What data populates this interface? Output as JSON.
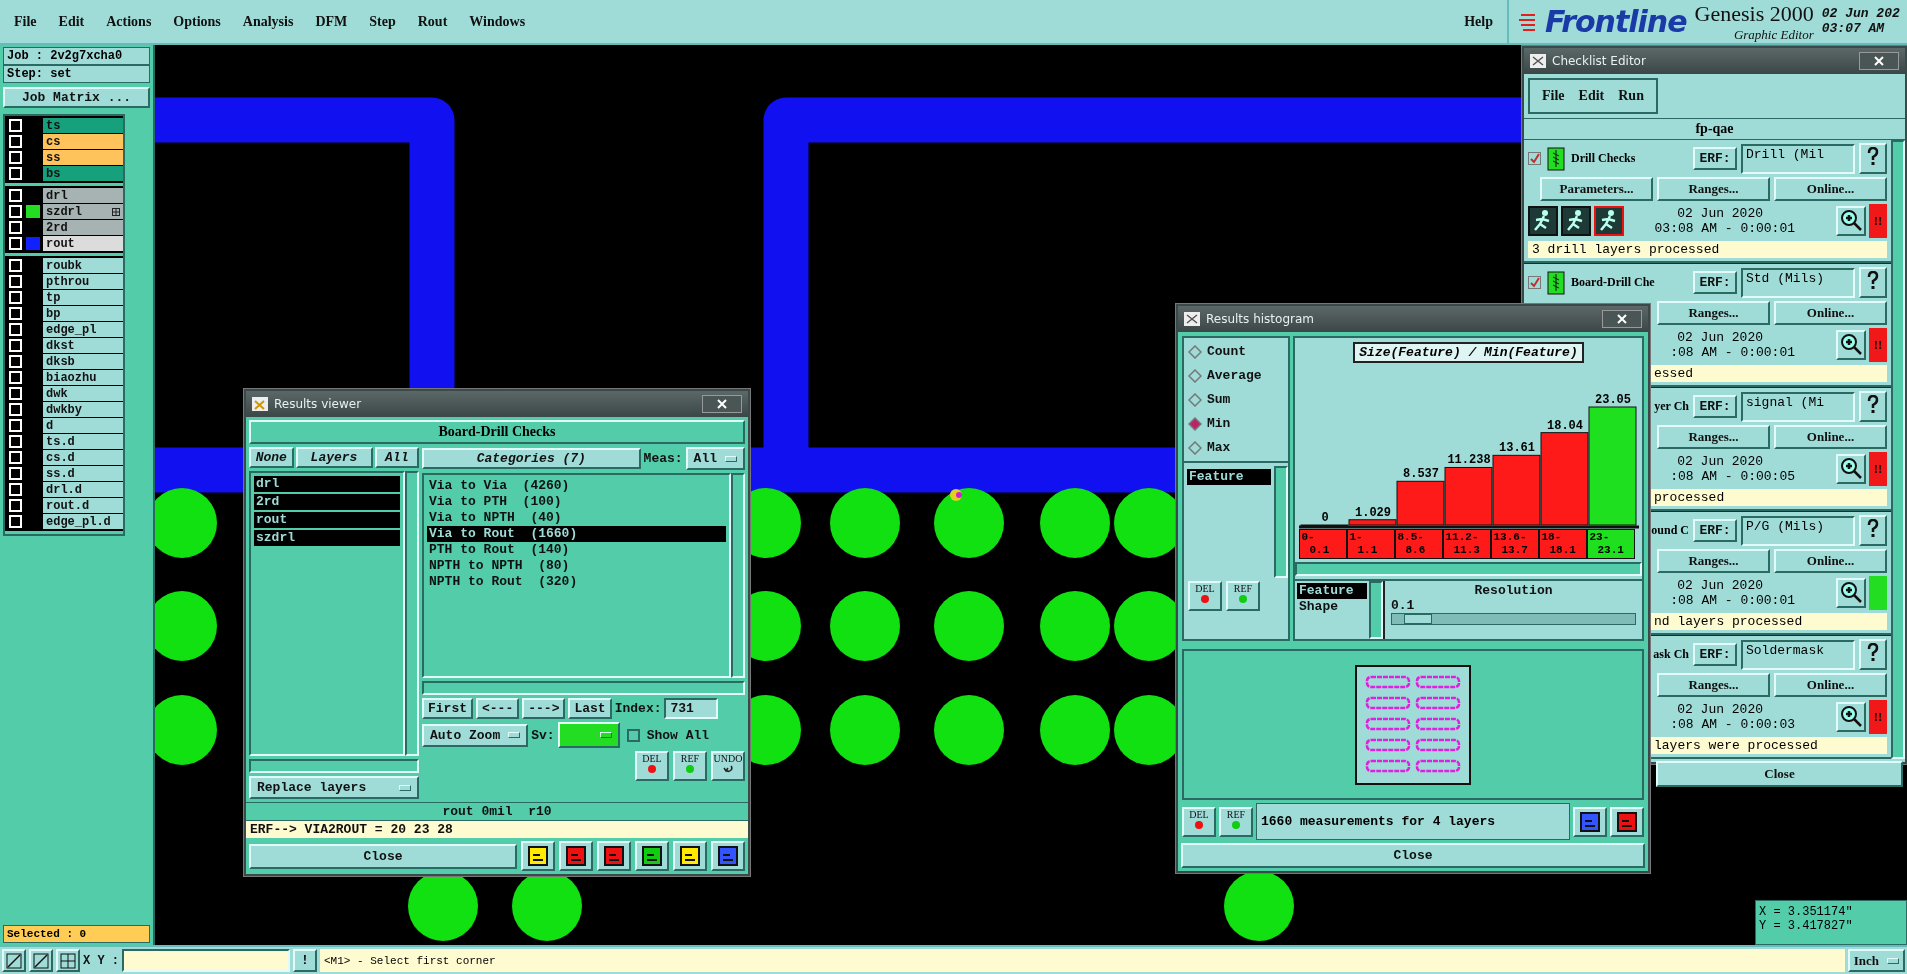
{
  "menu_bar": {
    "items": [
      "File",
      "Edit",
      "Actions",
      "Options",
      "Analysis",
      "DFM",
      "Step",
      "Rout",
      "Windows"
    ],
    "help": "Help"
  },
  "branding": {
    "logo": "Frontline",
    "product": "Genesis 2000",
    "subtitle": "Graphic Editor",
    "date": "02 Jun 202",
    "time": "03:07 AM"
  },
  "job_panel": {
    "job": "Job : 2v2g7xcha0",
    "step": "Step: set",
    "matrix_button": "Job Matrix ...",
    "layer_groups": [
      {
        "layers": [
          {
            "name": "ts",
            "color": "#16a07c",
            "checked": false
          },
          {
            "name": "cs",
            "color": "#ffc35c",
            "checked": false
          },
          {
            "name": "ss",
            "color": "#ffc35c",
            "checked": false
          },
          {
            "name": "bs",
            "color": "#16a07c",
            "checked": false
          }
        ]
      },
      {
        "layers": [
          {
            "name": "drl",
            "color": "#a7b2b2",
            "checked": false
          },
          {
            "name": "szdrl",
            "color": "#a7b2b2",
            "checked": false,
            "swatch": {
              "color": "#22dd22"
            },
            "attributes": true
          },
          {
            "name": "2rd",
            "color": "#a7b2b2",
            "checked": false
          },
          {
            "name": "rout",
            "color": "#dcdcdc",
            "checked": false,
            "swatch": {
              "color": "#1020ff"
            }
          }
        ]
      },
      {
        "layers": [
          {
            "name": "roubk",
            "color": "#9fdcd8",
            "checked": false
          },
          {
            "name": "pthrou",
            "color": "#9fdcd8",
            "checked": false
          },
          {
            "name": "tp",
            "color": "#9fdcd8",
            "checked": false
          },
          {
            "name": "bp",
            "color": "#9fdcd8",
            "checked": false
          },
          {
            "name": "edge_pl",
            "color": "#9fdcd8",
            "checked": false
          },
          {
            "name": "dkst",
            "color": "#9fdcd8",
            "checked": false
          },
          {
            "name": "dksb",
            "color": "#9fdcd8",
            "checked": false
          },
          {
            "name": "biaozhu",
            "color": "#9fdcd8",
            "checked": false
          },
          {
            "name": "dwk",
            "color": "#9fdcd8",
            "checked": false
          },
          {
            "name": "dwkby",
            "color": "#9fdcd8",
            "checked": false
          },
          {
            "name": "d",
            "color": "#9fdcd8",
            "checked": false
          },
          {
            "name": "ts.d",
            "color": "#9fdcd8",
            "checked": false
          },
          {
            "name": "cs.d",
            "color": "#9fdcd8",
            "checked": false
          },
          {
            "name": "ss.d",
            "color": "#9fdcd8",
            "checked": false
          },
          {
            "name": "drl.d",
            "color": "#9fdcd8",
            "checked": false
          },
          {
            "name": "rout.d",
            "color": "#9fdcd8",
            "checked": false
          },
          {
            "name": "edge_pl.d",
            "color": "#9fdcd8",
            "checked": false
          }
        ]
      }
    ],
    "selected": "Selected : 0"
  },
  "results_viewer": {
    "title": "Results viewer",
    "heading": "Board-Drill Checks",
    "layer_buttons": [
      "None",
      "Layers",
      "All"
    ],
    "layers": [
      {
        "name": "drl",
        "selected": true
      },
      {
        "name": "2rd",
        "selected": true
      },
      {
        "name": "rout",
        "selected": true
      },
      {
        "name": "szdrl",
        "selected": true
      }
    ],
    "categories_button": "Categories (7)",
    "meas_label": "Meas:",
    "meas_value": "All",
    "categories": [
      {
        "label": "Via to Via  (4260)",
        "selected": false
      },
      {
        "label": "Via to PTH  (100)",
        "selected": false
      },
      {
        "label": "Via to NPTH  (40)",
        "selected": false
      },
      {
        "label": "Via to Rout  (1660)",
        "selected": true
      },
      {
        "label": "PTH to Rout  (140)",
        "selected": false
      },
      {
        "label": "NPTH to NPTH  (80)",
        "selected": false
      },
      {
        "label": "NPTH to Rout  (320)",
        "selected": false
      }
    ],
    "nav_buttons": [
      "First",
      "<---",
      "--->",
      "Last"
    ],
    "index_label": "Index:",
    "index_value": "731",
    "zoom_mode": "Auto Zoom",
    "sv_label": "Sv:",
    "show_all": {
      "label": "Show All",
      "checked": false
    },
    "replace_mode": "Replace layers",
    "actions": [
      {
        "label": "DEL",
        "kind": "delete"
      },
      {
        "label": "REF",
        "kind": "refresh"
      },
      {
        "label": "UNDO",
        "kind": "undo"
      }
    ],
    "info": "rout 0mil  r10",
    "erf": "ERF--> VIA2ROUT = 20 23 28",
    "close": "Close"
  },
  "histogram": {
    "title": "Results histogram",
    "modes": [
      {
        "label": "Count",
        "selected": false
      },
      {
        "label": "Average",
        "selected": false
      },
      {
        "label": "Sum",
        "selected": false
      },
      {
        "label": "Min",
        "selected": true
      },
      {
        "label": "Max",
        "selected": false
      }
    ],
    "fields": [
      {
        "label": "Feature",
        "selected": true
      }
    ],
    "actions": [
      {
        "label": "DEL",
        "kind": "delete"
      },
      {
        "label": "REF",
        "kind": "refresh"
      }
    ],
    "chart_data": {
      "type": "bar",
      "title": "Size(Feature) / Min(Feature)",
      "categories": [
        "0-0.1",
        "1-1.1",
        "8.5-8.6",
        "11.2-11.3",
        "13.6-13.7",
        "18-18.1",
        "23-23.1"
      ],
      "series": [
        {
          "color": "#ff1a1a",
          "values": [
            0,
            1.029,
            8.537,
            11.238,
            13.61,
            18.04,
            null
          ]
        },
        {
          "color": "#1ee01e",
          "values": [
            null,
            null,
            null,
            null,
            null,
            null,
            23.05
          ]
        }
      ],
      "data_labels": true
    },
    "group_by": [
      {
        "label": "Feature",
        "selected": true
      },
      {
        "label": "Shape",
        "selected": false
      }
    ],
    "resolution": {
      "label": "Resolution",
      "value": "0.1",
      "level": 0.05
    },
    "summary_actions": [
      {
        "label": "DEL",
        "kind": "delete"
      },
      {
        "label": "REF",
        "kind": "refresh"
      }
    ],
    "summary": "1660 measurements for 4 layers",
    "close": "Close"
  },
  "checklist": {
    "title": "Checklist Editor",
    "menu": [
      "File",
      "Edit",
      "Run"
    ],
    "name": "fp-qae",
    "checks": [
      {
        "check": {
          "checked": true
        },
        "name": "Drill Checks",
        "erf_label": "ERF:",
        "erf": "Drill (Mil",
        "buttons": [
          "Parameters...",
          "Ranges...",
          "Online..."
        ],
        "run_icons": true,
        "date": "02 Jun 2020",
        "time": "03:08 AM - 0:00:01",
        "color": "#f01818",
        "flag": "!!",
        "message": "3 drill layers processed"
      },
      {
        "check": {
          "checked": true
        },
        "name": "Board-Drill Che",
        "erf_label": "ERF:",
        "erf": "Std (Mils)",
        "buttons": [
          "Ranges...",
          "Online..."
        ],
        "date": "02 Jun 2020",
        "time": ":08 AM - 0:00:01",
        "color": "#f01818",
        "flag": "!!",
        "message": "essed"
      },
      {
        "name": "yer Ch",
        "erf_label": "ERF:",
        "erf": "signal (Mi",
        "buttons": [
          "Ranges...",
          "Online..."
        ],
        "date": "02 Jun 2020",
        "time": ":08 AM - 0:00:05",
        "color": "#f01818",
        "flag": "!!",
        "message": "processed"
      },
      {
        "name": "ound C",
        "erf_label": "ERF:",
        "erf": "P/G (Mils)",
        "buttons": [
          "Ranges...",
          "Online..."
        ],
        "date": "02 Jun 2020",
        "time": ":08 AM - 0:00:01",
        "color": "#22dd22",
        "message": "nd layers processed"
      },
      {
        "name": "ask Ch",
        "erf_label": "ERF:",
        "erf": "Soldermask",
        "buttons": [
          "Ranges...",
          "Online..."
        ],
        "date": "02 Jun 2020",
        "time": ":08 AM - 0:00:03",
        "color": "#f01818",
        "flag": "!!",
        "message": "layers were processed"
      }
    ],
    "close": "Close"
  },
  "coordinates": {
    "x": "X = 3.351174\"",
    "y": "Y = 3.417827\""
  },
  "status_bar": {
    "xy_label": "X Y :",
    "alert": "!",
    "message": "<M1> - Select first corner",
    "units": "Inch"
  }
}
